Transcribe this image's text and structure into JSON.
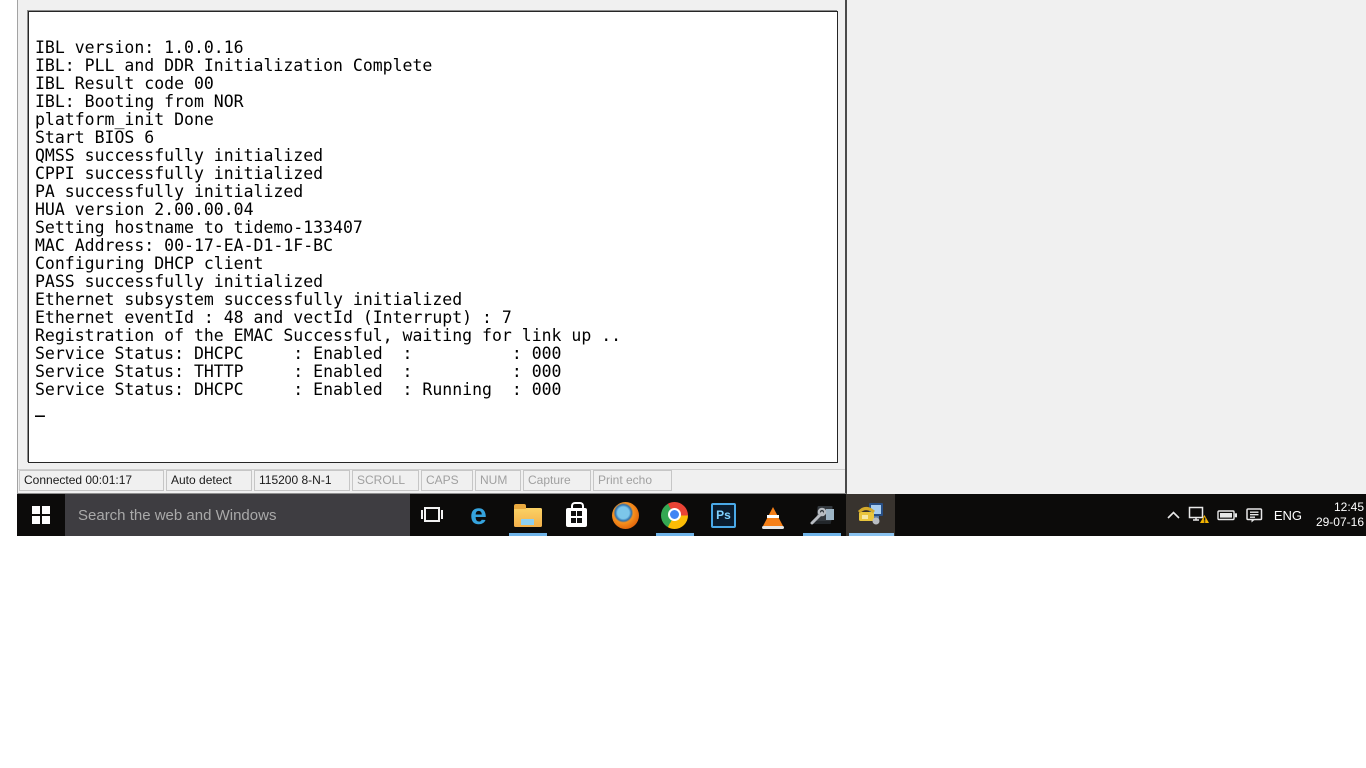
{
  "terminal_window": {
    "output_lines": [
      "IBL version: 1.0.0.16",
      "IBL: PLL and DDR Initialization Complete",
      "IBL Result code 00",
      "IBL: Booting from NOR",
      "platform_init Done",
      "Start BIOS 6",
      "QMSS successfully initialized",
      "CPPI successfully initialized",
      "PA successfully initialized",
      "HUA version 2.00.00.04",
      "Setting hostname to tidemo-133407",
      "MAC Address: 00-17-EA-D1-1F-BC",
      "Configuring DHCP client",
      "PASS successfully initialized",
      "Ethernet subsystem successfully initialized",
      "Ethernet eventId : 48 and vectId (Interrupt) : 7",
      "Registration of the EMAC Successful, waiting for link up ..",
      "Service Status: DHCPC     : Enabled  :          : 000",
      "Service Status: THTTP     : Enabled  :          : 000",
      "Service Status: DHCPC     : Enabled  : Running  : 000"
    ],
    "cursor": "_",
    "status_bar": {
      "panes": [
        {
          "label": "Connected 00:01:17",
          "state": "active"
        },
        {
          "label": "Auto detect",
          "state": "active"
        },
        {
          "label": "115200 8-N-1",
          "state": "active"
        },
        {
          "label": "SCROLL",
          "state": "disabled"
        },
        {
          "label": "CAPS",
          "state": "disabled"
        },
        {
          "label": "NUM",
          "state": "disabled"
        },
        {
          "label": "Capture",
          "state": "disabled"
        },
        {
          "label": "Print echo",
          "state": "disabled"
        }
      ]
    }
  },
  "taskbar": {
    "search": {
      "placeholder": "Search the web and Windows"
    },
    "edge_glyph": "e",
    "ps_label": "Ps",
    "apps": [
      {
        "icon": "start-icon",
        "active": false,
        "underline": false
      },
      {
        "icon": "task-view-icon",
        "active": false,
        "underline": false
      },
      {
        "icon": "edge-icon",
        "active": false,
        "underline": false
      },
      {
        "icon": "file-explorer-icon",
        "active": false,
        "underline": true
      },
      {
        "icon": "store-icon",
        "active": false,
        "underline": false
      },
      {
        "icon": "firefox-icon",
        "active": false,
        "underline": false
      },
      {
        "icon": "chrome-icon",
        "active": false,
        "underline": true
      },
      {
        "icon": "photoshop-icon",
        "active": false,
        "underline": false
      },
      {
        "icon": "vlc-icon",
        "active": false,
        "underline": false
      },
      {
        "icon": "hardware-utility-icon",
        "active": false,
        "underline": true
      },
      {
        "icon": "hyperterminal-icon",
        "active": true,
        "underline": true
      }
    ],
    "tray": {
      "icons": [
        "chevron-up-icon",
        "network-warning-icon",
        "battery-icon",
        "action-center-icon"
      ],
      "language": "ENG",
      "time": "12:45",
      "date": "29-07-16"
    }
  },
  "colors": {
    "taskbar_bg": "#0c0b0a",
    "searchbox_bg": "#3e3d41",
    "underline_accent": "#6fb3e8",
    "active_app_bg": "#38332e",
    "desktop_bg": "#f0f0f0",
    "terminal_bg": "#ffffff",
    "terminal_text": "#000000",
    "warning_yellow": "#f4b400"
  }
}
